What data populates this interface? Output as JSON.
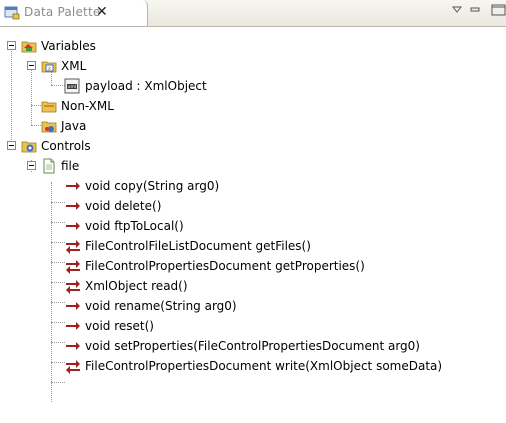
{
  "view": {
    "title": "Data Palette",
    "close_glyph": "✕"
  },
  "tree": {
    "variables": {
      "label": "Variables",
      "icon": "variables-folder-icon",
      "children": {
        "xml": {
          "label": "XML",
          "icon": "xml-folder-icon",
          "children": [
            {
              "label": "payload : XmlObject",
              "icon": "xml-document-icon"
            }
          ]
        },
        "nonxml": {
          "label": "Non-XML",
          "icon": "non-xml-folder-icon"
        },
        "java": {
          "label": "Java",
          "icon": "java-folder-icon"
        }
      }
    },
    "controls": {
      "label": "Controls",
      "icon": "controls-folder-icon",
      "file": {
        "label": "file",
        "icon": "file-icon",
        "methods": [
          {
            "label": "void copy(String arg0)",
            "icon": "arrow-right-icon"
          },
          {
            "label": "void delete()",
            "icon": "arrow-right-icon"
          },
          {
            "label": "void ftpToLocal()",
            "icon": "arrow-right-icon"
          },
          {
            "label": "FileControlFileListDocument getFiles()",
            "icon": "arrow-two-way-icon"
          },
          {
            "label": "FileControlPropertiesDocument getProperties()",
            "icon": "arrow-two-way-icon"
          },
          {
            "label": "XmlObject read()",
            "icon": "arrow-two-way-icon"
          },
          {
            "label": "void rename(String arg0)",
            "icon": "arrow-right-icon"
          },
          {
            "label": "void reset()",
            "icon": "arrow-right-icon"
          },
          {
            "label": "void setProperties(FileControlPropertiesDocument arg0)",
            "icon": "arrow-right-icon"
          },
          {
            "label": "FileControlPropertiesDocument write(XmlObject someData)",
            "icon": "arrow-two-way-icon"
          }
        ]
      }
    }
  },
  "colors": {
    "folder": "#e8c34e",
    "variables_badge": "#d0342c",
    "controls_badge": "#3a6fd0",
    "arrow_red": "#a02020"
  }
}
